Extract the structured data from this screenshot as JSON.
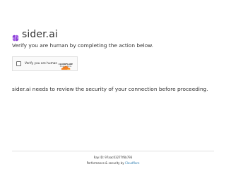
{
  "header": {
    "logo_icon": "sider-brain-icon",
    "logo_color": "#8b3fd6",
    "site_name": "sider.ai"
  },
  "verify_message": "Verify you are human by completing the action below.",
  "widget": {
    "checkbox_label": "Verify you are human",
    "brand_name": "CLOUDFLARE",
    "brand_color": "#f38020",
    "privacy_label": "Privacy",
    "terms_label": "Terms",
    "link_separator": "·"
  },
  "review_message": "sider.ai needs to review the security of your connection before proceeding.",
  "footer": {
    "ray_id": "Ray ID: 97aac03277f6b793",
    "performance_prefix": "Performance & security by ",
    "performance_link": "Cloudflare",
    "link_color": "#2c7cb0"
  }
}
